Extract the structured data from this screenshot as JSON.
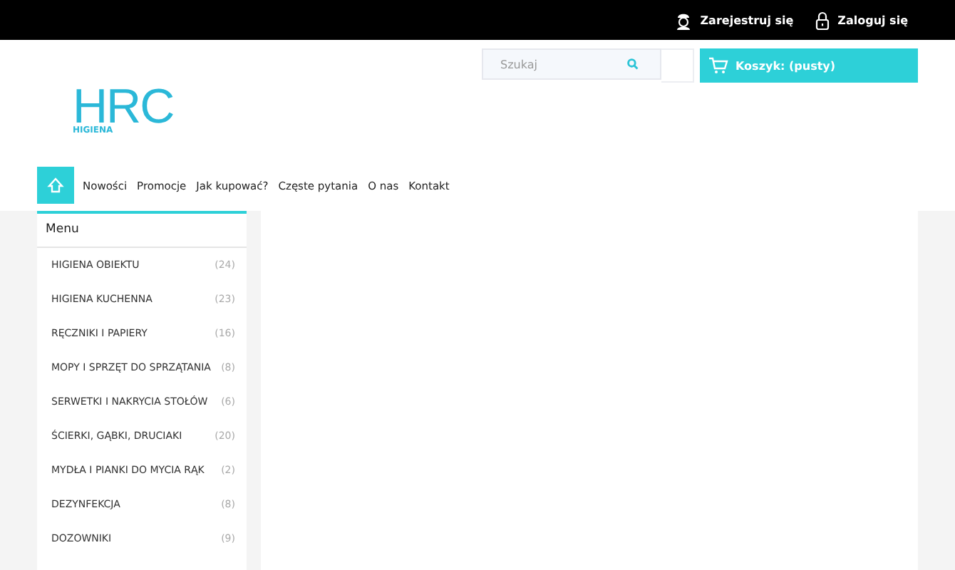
{
  "top_bar": {
    "links": [
      {
        "kind": "register",
        "label": "Zarejestruj się"
      },
      {
        "kind": "login",
        "label": "Zaloguj się"
      }
    ]
  },
  "header": {
    "logo": {
      "mark": "HRC",
      "subtitle": "HIGIENA"
    },
    "search": {
      "placeholder": "Szukaj"
    },
    "cart": {
      "label": "Koszyk: (pusty)"
    }
  },
  "nav": {
    "items": [
      "Nowości",
      "Promocje",
      "Jak kupować?",
      "Częste pytania",
      "O nas",
      "Kontakt"
    ]
  },
  "sidebar": {
    "title": "Menu",
    "items": [
      {
        "label": "HIGIENA OBIEKTU",
        "count": "(24)"
      },
      {
        "label": "HIGIENA KUCHENNA",
        "count": "(23)"
      },
      {
        "label": "RĘCZNIKI I PAPIERY",
        "count": "(16)"
      },
      {
        "label": "MOPY I SPRZĘT DO SPRZĄTANIA",
        "count": "(8)"
      },
      {
        "label": "SERWETKI I NAKRYCIA STOŁÓW",
        "count": "(6)"
      },
      {
        "label": "ŚCIERKI, GĄBKI, DRUCIAKI",
        "count": "(20)"
      },
      {
        "label": "MYDŁA I PIANKI DO MYCIA RĄK",
        "count": "(2)"
      },
      {
        "label": "DEZYNFEKCJA",
        "count": "(8)"
      },
      {
        "label": "DOZOWNIKI",
        "count": "(9)"
      }
    ]
  }
}
